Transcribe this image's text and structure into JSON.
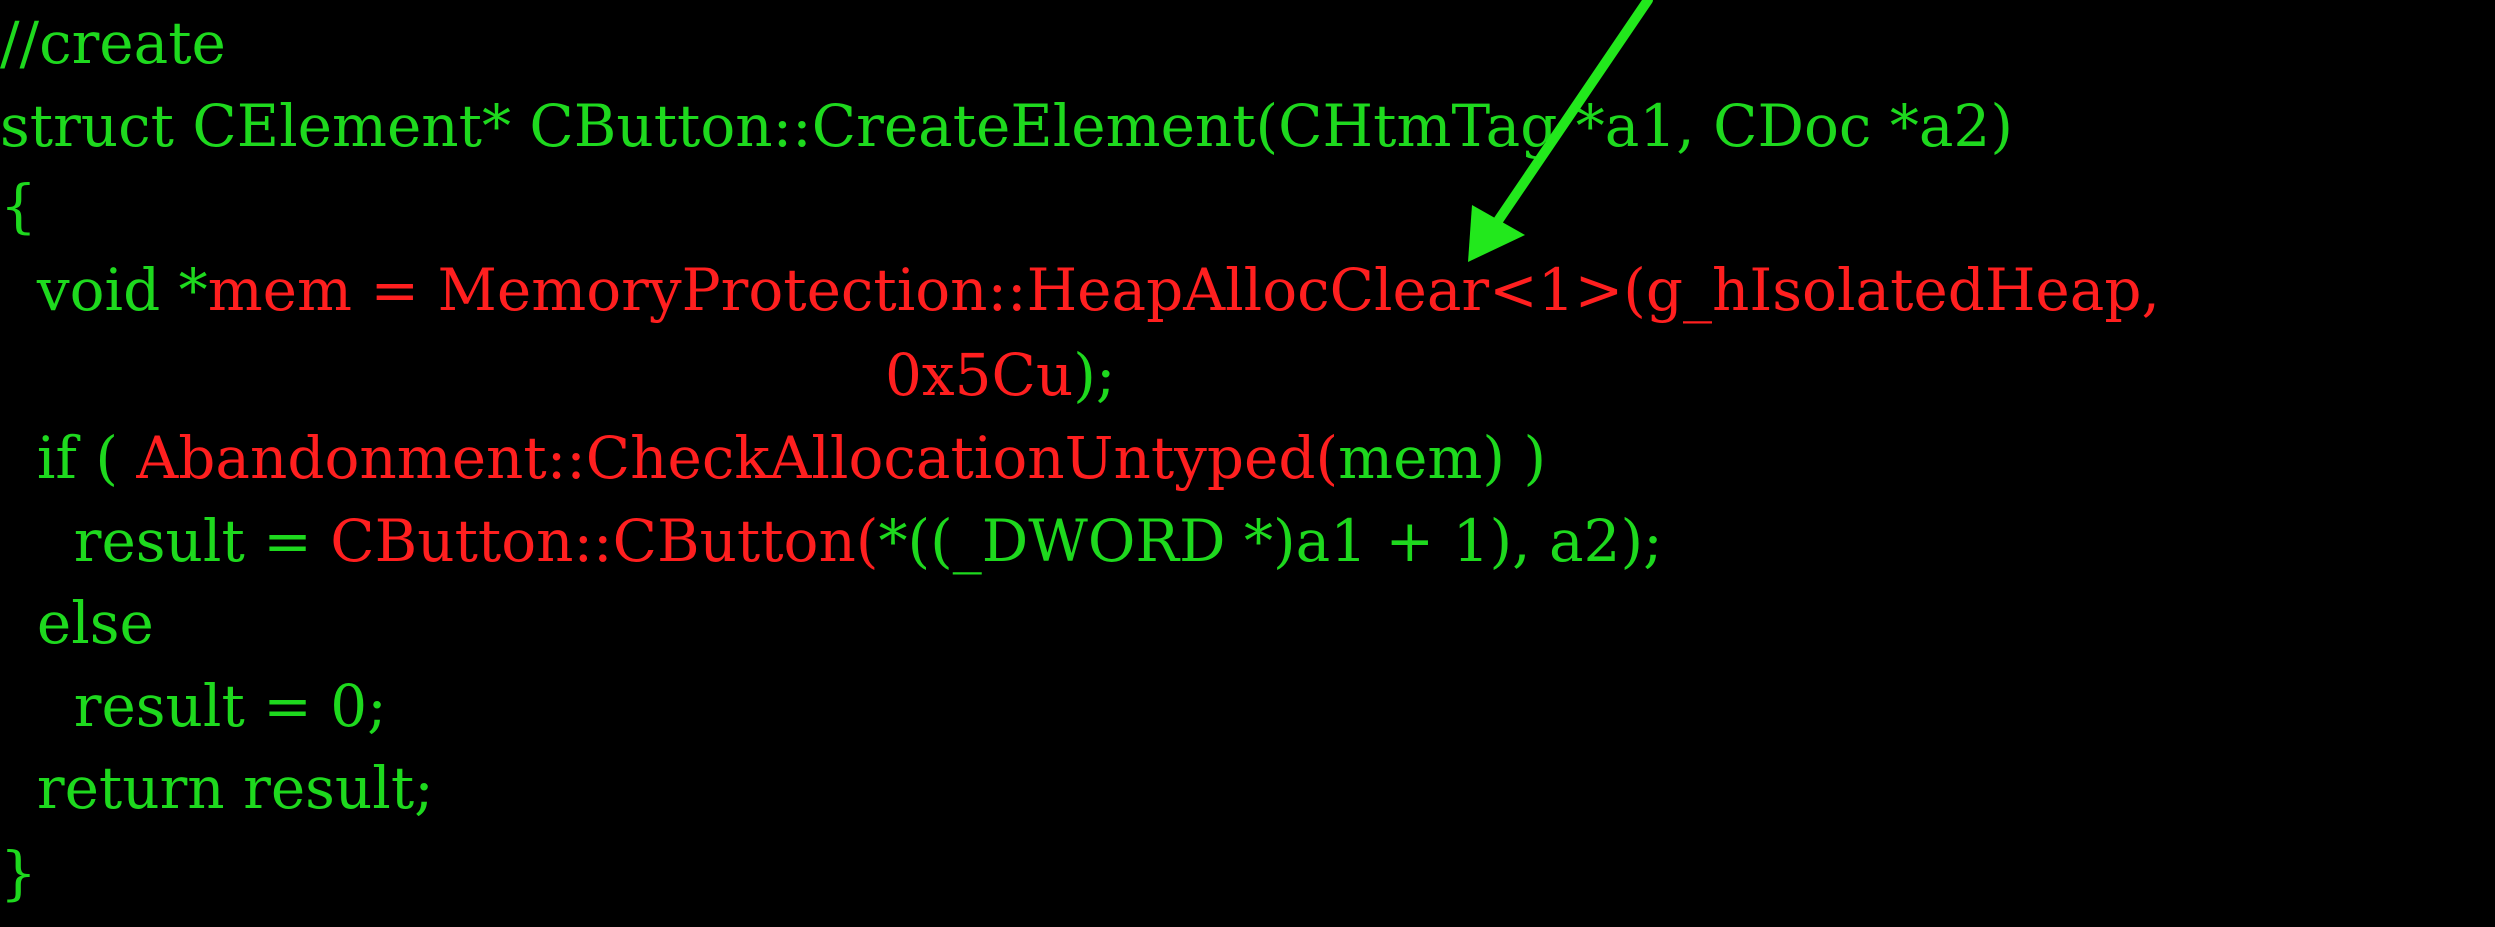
{
  "colors": {
    "background": "#000000",
    "code_text": "#1ED91E",
    "highlight_text": "#FF1F1F",
    "arrow": "#22E81C"
  },
  "icons": {
    "annotation_arrow": "green-arrow-icon"
  },
  "code": {
    "lines": [
      [
        {
          "text": "//create",
          "color": "green"
        }
      ],
      [
        {
          "text": "struct CElement* CButton::CreateElement(CHtmTag *a1, CDoc *a2)",
          "color": "green"
        }
      ],
      [
        {
          "text": "{",
          "color": "green"
        }
      ],
      [
        {
          "text": "  void *",
          "color": "green"
        },
        {
          "text": "mem = MemoryProtection::HeapAllocClear<1>(",
          "color": "red"
        },
        {
          "text": "g_hIsolatedHeap,",
          "color": "red"
        }
      ],
      [
        {
          "text": "                                                0x5Cu",
          "color": "red"
        },
        {
          "text": ");",
          "color": "green"
        }
      ],
      [
        {
          "text": "  if ( ",
          "color": "green"
        },
        {
          "text": "Abandonment::CheckAllocationUntyped(",
          "color": "red"
        },
        {
          "text": "mem) )",
          "color": "green"
        }
      ],
      [
        {
          "text": "    result = ",
          "color": "green"
        },
        {
          "text": "CButton::CButton(",
          "color": "red"
        },
        {
          "text": "*((_DWORD *)a1 + 1), a2);",
          "color": "green"
        }
      ],
      [
        {
          "text": "  else",
          "color": "green"
        }
      ],
      [
        {
          "text": "    result = 0;",
          "color": "green"
        }
      ],
      [
        {
          "text": "  return result;",
          "color": "green"
        }
      ],
      [
        {
          "text": "}",
          "color": "green"
        }
      ]
    ]
  }
}
